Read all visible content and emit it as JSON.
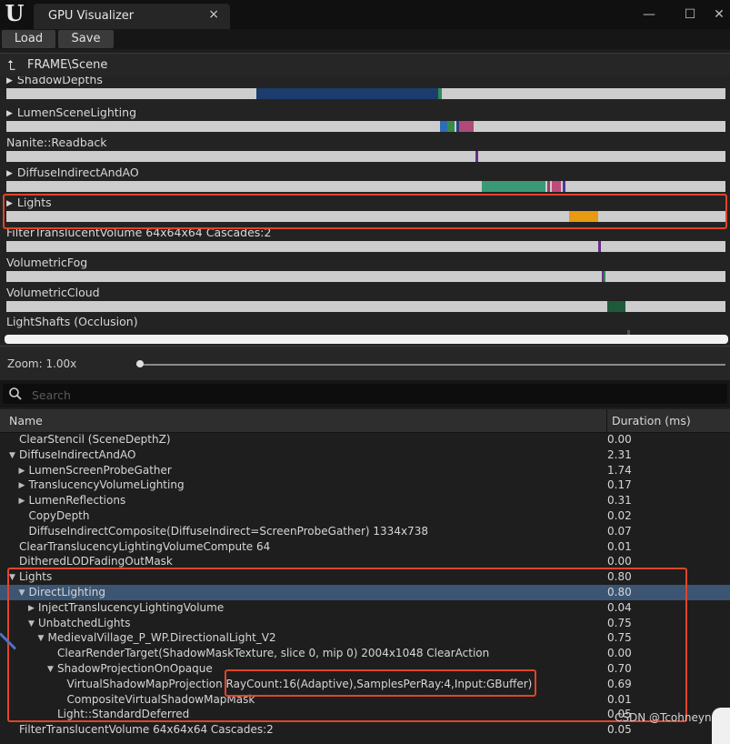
{
  "window": {
    "tab_title": "GPU Visualizer",
    "close_glyph": "×",
    "minimize_glyph": "—",
    "maximize_glyph": "☐",
    "window_close_glyph": "✕"
  },
  "toolbar": {
    "load_label": "Load",
    "save_label": "Save"
  },
  "breadcrumb": {
    "path": "FRAME\\Scene"
  },
  "timeline": {
    "rows": [
      {
        "label": "ShadowDepths",
        "expandable": true
      },
      {
        "label": "LumenSceneLighting",
        "expandable": true
      },
      {
        "label": "Nanite::Readback",
        "expandable": false
      },
      {
        "label": "DiffuseIndirectAndAO",
        "expandable": true
      },
      {
        "label": "Lights",
        "expandable": true
      },
      {
        "label": "FilterTranslucentVolume 64x64x64 Cascades:2",
        "expandable": false
      },
      {
        "label": "VolumetricFog",
        "expandable": false
      },
      {
        "label": "VolumetricCloud",
        "expandable": false
      },
      {
        "label": "LightShafts (Occlusion)",
        "expandable": false
      }
    ]
  },
  "zoom": {
    "label": "Zoom: 1.00x",
    "value": 1.0
  },
  "search": {
    "placeholder": "Search"
  },
  "table": {
    "headers": {
      "name": "Name",
      "duration": "Duration (ms)"
    },
    "rows": [
      {
        "name": "ClearStencil (SceneDepthZ)",
        "duration": "0.00",
        "depth": 0,
        "tri": ""
      },
      {
        "name": "DiffuseIndirectAndAO",
        "duration": "2.31",
        "depth": 0,
        "tri": "down"
      },
      {
        "name": "LumenScreenProbeGather",
        "duration": "1.74",
        "depth": 1,
        "tri": "right"
      },
      {
        "name": "TranslucencyVolumeLighting",
        "duration": "0.17",
        "depth": 1,
        "tri": "right"
      },
      {
        "name": "LumenReflections",
        "duration": "0.31",
        "depth": 1,
        "tri": "right"
      },
      {
        "name": "CopyDepth",
        "duration": "0.02",
        "depth": 1,
        "tri": ""
      },
      {
        "name": "DiffuseIndirectComposite(DiffuseIndirect=ScreenProbeGather) 1334x738",
        "duration": "0.07",
        "depth": 1,
        "tri": ""
      },
      {
        "name": "ClearTranslucencyLightingVolumeCompute 64",
        "duration": "0.01",
        "depth": 0,
        "tri": ""
      },
      {
        "name": "DitheredLODFadingOutMask",
        "duration": "0.00",
        "depth": 0,
        "tri": ""
      },
      {
        "name": "Lights",
        "duration": "0.80",
        "depth": 0,
        "tri": "down"
      },
      {
        "name": "DirectLighting",
        "duration": "0.80",
        "depth": 1,
        "tri": "down",
        "selected": true
      },
      {
        "name": "InjectTranslucencyLightingVolume",
        "duration": "0.04",
        "depth": 2,
        "tri": "right"
      },
      {
        "name": "UnbatchedLights",
        "duration": "0.75",
        "depth": 2,
        "tri": "down"
      },
      {
        "name": "MedievalVillage_P_WP.DirectionalLight_V2",
        "duration": "0.75",
        "depth": 3,
        "tri": "down"
      },
      {
        "name": "ClearRenderTarget(ShadowMaskTexture, slice 0, mip 0) 2004x1048 ClearAction",
        "duration": "0.00",
        "depth": 4,
        "tri": ""
      },
      {
        "name": "ShadowProjectionOnOpaque",
        "duration": "0.70",
        "depth": 4,
        "tri": "down"
      },
      {
        "name": "VirtualShadowMapProjection RayCount:16(Adaptive),SamplesPerRay:4,Input:GBuffer)",
        "duration": "0.69",
        "depth": 5,
        "tri": ""
      },
      {
        "name": "CompositeVirtualShadowMapMask",
        "duration": "0.01",
        "depth": 5,
        "tri": ""
      },
      {
        "name": "Light::StandardDeferred",
        "duration": "0.05",
        "depth": 4,
        "tri": ""
      },
      {
        "name": "FilterTranslucentVolume 64x64x64 Cascades:2",
        "duration": "0.05",
        "depth": 0,
        "tri": ""
      }
    ]
  },
  "watermark": "CSDN @Tcohneyn",
  "colors": {
    "highlight_box": "#e0452b",
    "selected_row": "#3c5573",
    "bar_background": "#cdcdcd"
  }
}
